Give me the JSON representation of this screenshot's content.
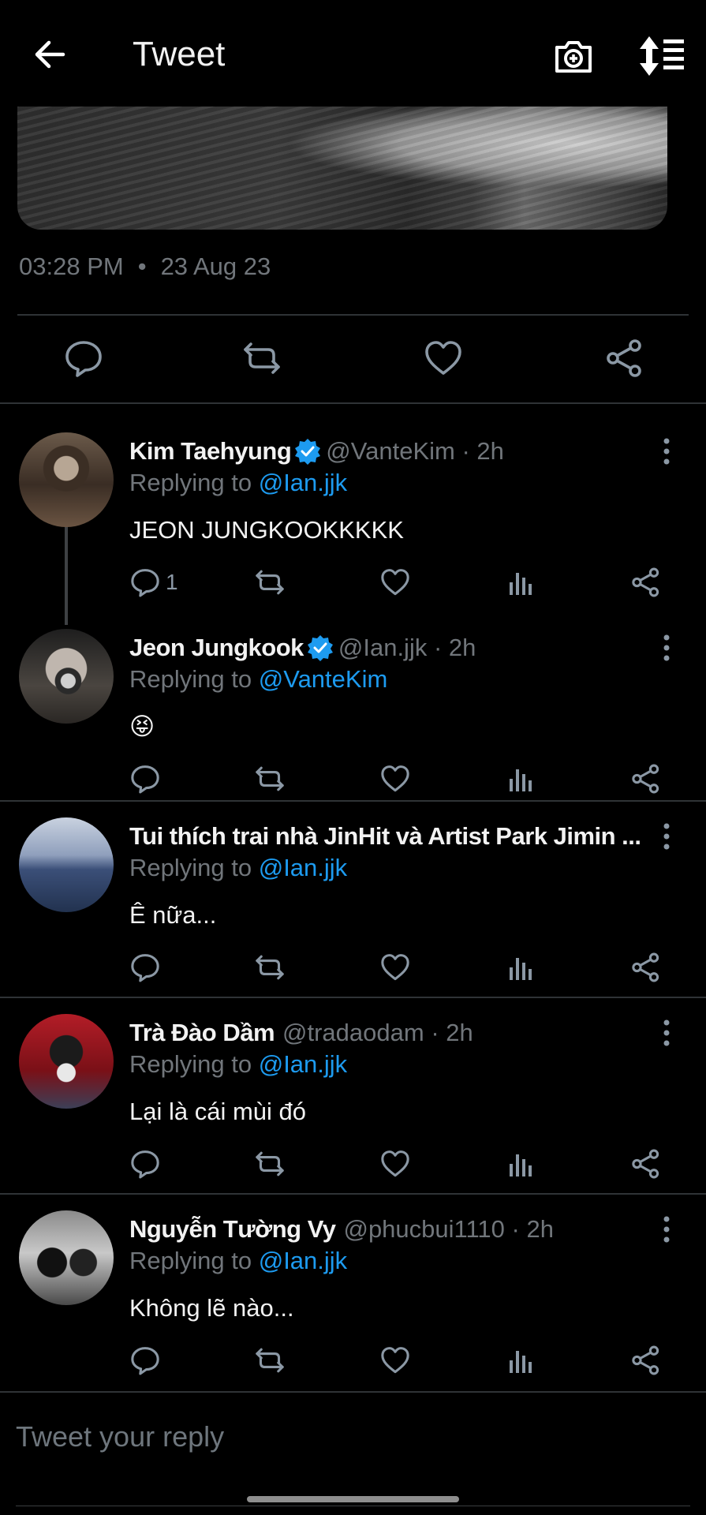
{
  "header": {
    "title": "Tweet"
  },
  "tweet": {
    "time": "03:28 PM",
    "separator": "•",
    "date": "23 Aug 23"
  },
  "replies": [
    {
      "display_name": "Kim Taehyung",
      "verified": true,
      "handle": "@VanteKim",
      "time": "2h",
      "replying_prefix": "Replying to",
      "replying_to": "@Ian.jjk",
      "text": "JEON JUNGKOOKKKKK",
      "reply_count": "1"
    },
    {
      "display_name": "Jeon Jungkook",
      "verified": true,
      "handle": "@Ian.jjk",
      "time": "2h",
      "replying_prefix": "Replying to",
      "replying_to": "@VanteKim",
      "text": "😝"
    },
    {
      "display_name": "Tui thích trai nhà JinHit và Artist Park Jimin ...",
      "verified": false,
      "replying_prefix": "Replying to",
      "replying_to": "@Ian.jjk",
      "text": "Ê nữa..."
    },
    {
      "display_name": "Trà Đào Dầm",
      "verified": false,
      "handle": "@tradaodam",
      "time": "2h",
      "replying_prefix": "Replying to",
      "replying_to": "@Ian.jjk",
      "text": "Lại là cái mùi đó"
    },
    {
      "display_name": "Nguyễn Tường Vy",
      "verified": false,
      "handle": "@phucbui1110",
      "time": "2h",
      "replying_prefix": "Replying to",
      "replying_to": "@Ian.jjk",
      "text": "Không  lẽ nào..."
    }
  ],
  "composer": {
    "placeholder": "Tweet your reply"
  },
  "colors": {
    "background": "#000000",
    "accent": "#1d9bf0",
    "muted": "#71767b",
    "divider": "#2f3336"
  }
}
